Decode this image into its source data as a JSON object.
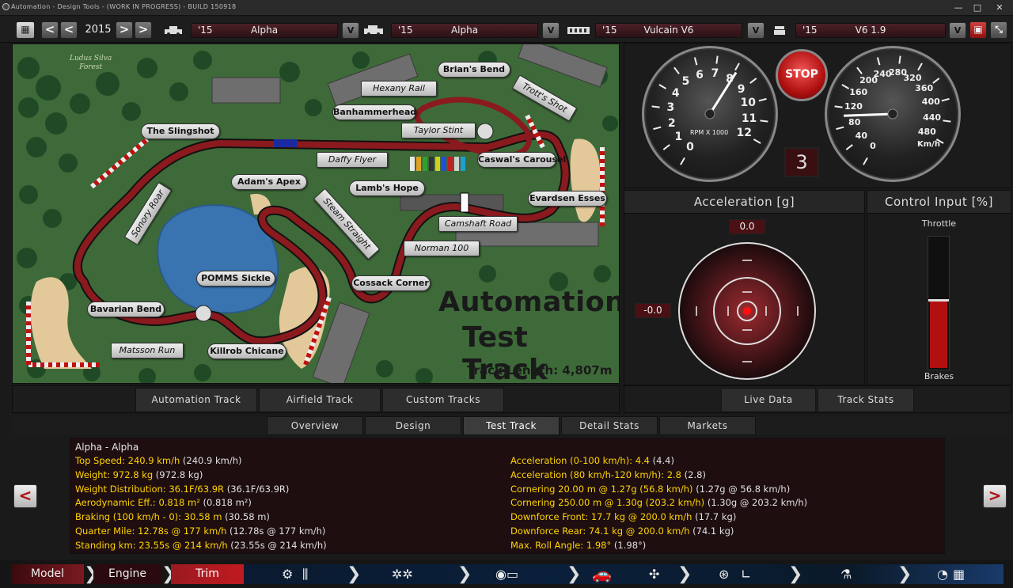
{
  "window": {
    "title": "Automation - Design Tools - (WORK IN PROGRESS) - BUILD 150918"
  },
  "toolbar": {
    "year": "2015",
    "prev_arrow": "<",
    "next_arrow": ">",
    "model": {
      "year": "'15",
      "name": "Alpha"
    },
    "trim": {
      "year": "'15",
      "name": "Alpha"
    },
    "engine": {
      "year": "'15",
      "name": "Vulcain V6"
    },
    "variant": {
      "year": "'15",
      "name": "V6 1.9"
    },
    "dropdown_glyph": "V"
  },
  "map": {
    "forest_label": "Ludus Silva\nForest",
    "title_line1": "Automation",
    "title_line2": "Test Track",
    "track_length": "Track Length: 4,807m",
    "labels": {
      "brians_bend": "Brian's Bend",
      "hexany_rail": "Hexany Rail",
      "trotts_shot": "Trott's Shot",
      "banhammerhead": "Banhammerhead",
      "taylor_stint": "Taylor Stint",
      "the_slingshot": "The Slingshot",
      "caswals_carousel": "Caswal's Carousel",
      "daffy_flyer": "Daffy Flyer",
      "adams_apex": "Adam's Apex",
      "lambs_hope": "Lamb's Hope",
      "evardsen_esses": "Evardsen Esses",
      "sonory_roar": "Sonory Roar",
      "steam_straight": "Steam Straight",
      "camshaft_road": "Camshaft Road",
      "norman_100": "Norman 100",
      "pomms_sickle": "POMMS Sickle",
      "cossack_corner": "Cossack Corner",
      "bavarian_bend": "Bavarian Bend",
      "matsson_run": "Matsson Run",
      "killrob_chicane": "Killrob Chicane"
    }
  },
  "track_tabs": [
    "Automation Track",
    "Airfield Track",
    "Custom Tracks"
  ],
  "gauges": {
    "stop_label": "STOP",
    "gear": "3",
    "rpm_label": "RPM X 1000",
    "rpm_ticks": [
      "0",
      "1",
      "2",
      "3",
      "4",
      "5",
      "6",
      "7",
      "8",
      "9",
      "10",
      "11",
      "12"
    ],
    "rpm_value": 8.1,
    "speed_label": "Km/h",
    "speed_ticks": [
      "0",
      "40",
      "80",
      "120",
      "160",
      "200",
      "240",
      "280",
      "320",
      "360",
      "400",
      "440",
      "480"
    ],
    "speed_value": 103
  },
  "acceleration": {
    "title": "Acceleration [g]",
    "long_value": "0.0",
    "lat_value": "-0.0"
  },
  "control_input": {
    "title": "Control Input [%]",
    "throttle_label": "Throttle",
    "brakes_label": "Brakes",
    "brakes_fraction": 0.52
  },
  "data_tabs": [
    "Live Data",
    "Track Stats"
  ],
  "main_tabs": [
    "Overview",
    "Design",
    "Test Track",
    "Detail Stats",
    "Markets"
  ],
  "active_main_tab": "Test Track",
  "stats": {
    "title": "Alpha - Alpha",
    "left": [
      {
        "k": "Top Speed: 240.9 km/h",
        "v": "(240.9 km/h)"
      },
      {
        "k": "Weight: 972.8 kg",
        "v": "(972.8 kg)"
      },
      {
        "k": "Weight Distribution: 36.1F/63.9R",
        "v": "(36.1F/63.9R)"
      },
      {
        "k": "Aerodynamic Eff.: 0.818 m²",
        "v": "(0.818 m²)"
      },
      {
        "k": "Braking (100 km/h - 0): 30.58 m",
        "v": "(30.58 m)"
      },
      {
        "k": "Quarter Mile: 12.78s @ 177 km/h",
        "v": "(12.78s @ 177 km/h)"
      },
      {
        "k": "Standing km: 23.55s @ 214 km/h",
        "v": "(23.55s @ 214 km/h)"
      }
    ],
    "right": [
      {
        "k": "Acceleration (0-100 km/h): 4.4",
        "v": "(4.4)"
      },
      {
        "k": "Acceleration (80 km/h-120 km/h): 2.8",
        "v": "(2.8)"
      },
      {
        "k": "Cornering 20.00 m @ 1.27g (56.8 km/h)",
        "v": "(1.27g @ 56.8 km/h)"
      },
      {
        "k": "Cornering 250.00 m @ 1.30g (203.2 km/h)",
        "v": "(1.30g @ 203.2 km/h)"
      },
      {
        "k": "Downforce Front: 17.7 kg @ 200.0 km/h",
        "v": "(17.7 kg)"
      },
      {
        "k": "Downforce Rear: 74.1 kg @ 200.0 km/h",
        "v": "(74.1 kg)"
      },
      {
        "k": "Max. Roll Angle: 1.98°",
        "v": "(1.98°)"
      }
    ]
  },
  "nav_arrows": {
    "left": "<",
    "right": ">"
  },
  "bottom_nav": {
    "model": "Model",
    "engine": "Engine",
    "trim": "Trim"
  },
  "colors": {
    "accent_red": "#b01010",
    "stat_key": "#ffd400",
    "track_red": "#8a1a1e",
    "grass": "#3e6a39"
  }
}
